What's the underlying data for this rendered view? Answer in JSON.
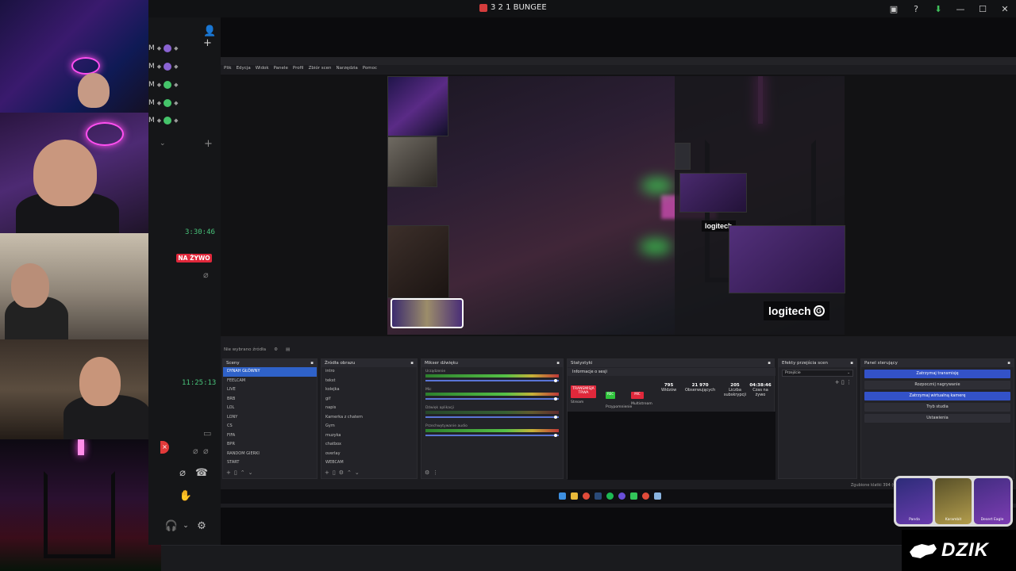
{
  "window": {
    "title": "3 2 1 BUNGEE"
  },
  "titlebar_icons": [
    {
      "name": "screen-share-icon",
      "glyph": "▣"
    },
    {
      "name": "help-icon",
      "glyph": "?"
    },
    {
      "name": "download-icon",
      "glyph": "⬇"
    },
    {
      "name": "minimize-icon",
      "glyph": "—"
    },
    {
      "name": "maximize-icon",
      "glyph": "☐"
    },
    {
      "name": "close-icon",
      "glyph": "✕"
    }
  ],
  "voice_users": [
    {
      "initial": "M",
      "color": "#8a63d2"
    },
    {
      "initial": "M",
      "color": "#8a63d2"
    },
    {
      "initial": "M",
      "color": "#45c46a"
    },
    {
      "initial": "M",
      "color": "#45c46a"
    },
    {
      "initial": "M",
      "color": "#45c46a"
    }
  ],
  "chat": {
    "time1": "3:30:46",
    "live_badge": "NA ŻYWO",
    "time2": "11:25:13"
  },
  "obs": {
    "menu": [
      "Plik",
      "Edycja",
      "Widok",
      "Panele",
      "Profil",
      "Zbiór scen",
      "Narzędzia",
      "Pomoc"
    ],
    "source_bar": "Nie wybrano źródła",
    "docks": {
      "scenes_title": "Sceny",
      "scenes": [
        "DYNAH GŁÓWNY",
        "FEELCAM",
        "LIVE",
        "BRB",
        "LOL",
        "LONY",
        "CS",
        "FIFA",
        "BPR",
        "RANDOM GIERKI",
        "START"
      ],
      "sources_title": "Źródła obrazu",
      "sources": [
        "intro",
        "tekst",
        "kolejka",
        "gif",
        "napis",
        "Kamerka z chatem",
        "Gym",
        "muzyka",
        "chatbox",
        "overlay",
        "WEBCAM"
      ],
      "mixer_title": "Mikser dźwięku",
      "mixer_channels": [
        "Urządzenie",
        "Mic",
        "Dźwięk aplikacji",
        "Przechwytywanie audio"
      ],
      "stats_title": "Statystyki",
      "session_title": "Informacje o sesji",
      "status_tiles": {
        "main": "TRANSMISJA TRWA",
        "rec": "REC",
        "mic": "MIC"
      },
      "status_sub": [
        "Stream",
        "Przypomnienie",
        "Multistream"
      ],
      "stats": [
        {
          "value": "795",
          "label": "Widzów"
        },
        {
          "value": "21 970",
          "label": "Obserwujących"
        },
        {
          "value": "205",
          "label": "Liczba subskrypcji"
        },
        {
          "value": "04:38:46",
          "label": "Czas na żywo"
        }
      ],
      "transitions_title": "Efekty przejścia scen",
      "transitions_value": "Przejście",
      "controls_title": "Panel sterujący",
      "controls": [
        "Zatrzymaj transmisję",
        "Rozpocznij nagrywanie",
        "Zatrzymaj wirtualną kamerę",
        "Tryb studia",
        "Ustawienia"
      ]
    },
    "status_line": "Zgubione klatki 394 (0.0%)",
    "logitech_brand": "logitech",
    "logitech_g": "G"
  },
  "overlay_cards": [
    "Panda",
    "Karambit",
    "Desert Eagle"
  ],
  "brand": {
    "dzik": "DZIK"
  }
}
